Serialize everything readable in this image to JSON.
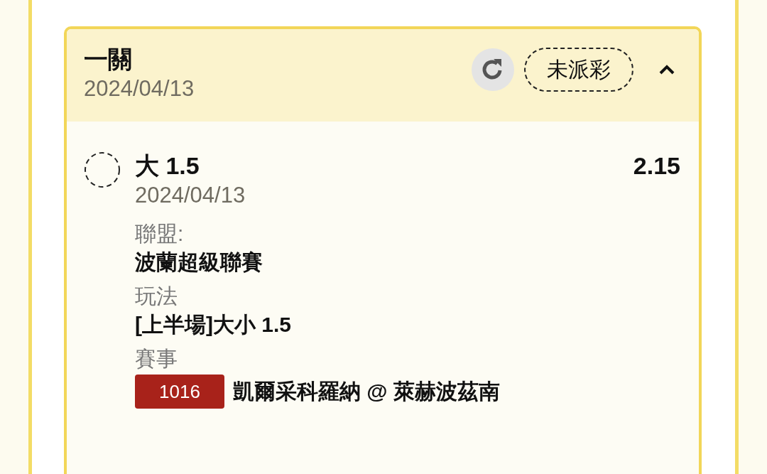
{
  "bet": {
    "title": "一關",
    "date": "2024/04/13",
    "status": "未派彩",
    "expanded": true
  },
  "selection": {
    "name": "大 1.5",
    "odds": "2.15",
    "date": "2024/04/13"
  },
  "fields": [
    {
      "kind": "text",
      "label": "聯盟:",
      "value": "波蘭超級聯賽"
    },
    {
      "kind": "text",
      "label": "玩法",
      "value": "[上半場]大小 1.5"
    },
    {
      "kind": "match",
      "label": "賽事",
      "badge": "1016",
      "value": "凱爾采科羅納 @ 萊赫波茲南"
    }
  ]
}
